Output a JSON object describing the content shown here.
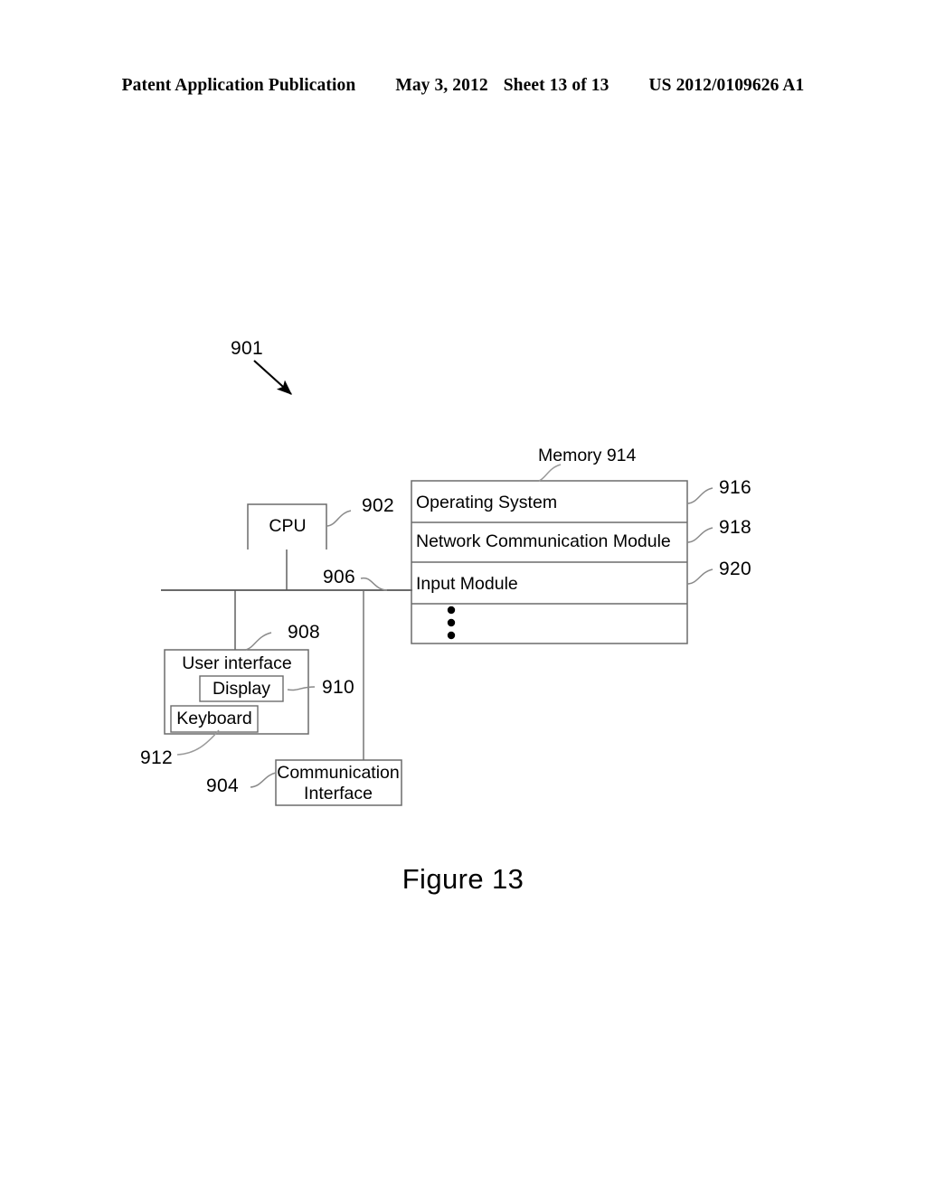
{
  "header": {
    "publication": "Patent Application Publication",
    "date": "May 3, 2012",
    "sheet": "Sheet 13 of 13",
    "patent_number": "US 2012/0109626 A1"
  },
  "figure": {
    "caption": "Figure 13",
    "system_ref": "901"
  },
  "diagram": {
    "cpu": {
      "label": "CPU",
      "ref": "902"
    },
    "bus": {
      "ref": "906"
    },
    "memory": {
      "title": "Memory 914",
      "ref": "914",
      "rows": [
        {
          "label": "Operating System",
          "ref": "916"
        },
        {
          "label": "Network Communication Module",
          "ref": "918"
        },
        {
          "label": "Input Module",
          "ref": "920"
        },
        {
          "label": "",
          "ref": ""
        }
      ],
      "ellipsis": "vertical-dots"
    },
    "user_interface": {
      "label": "User interface",
      "ref": "908",
      "display": {
        "label": "Display",
        "ref": "910"
      },
      "keyboard": {
        "label": "Keyboard",
        "ref": "912"
      }
    },
    "communication_interface": {
      "label_line1": "Communication",
      "label_line2": "Interface",
      "ref": "904"
    }
  },
  "colors": {
    "ink": "#000000",
    "stroke": "#6b6b6b",
    "background": "#ffffff"
  }
}
